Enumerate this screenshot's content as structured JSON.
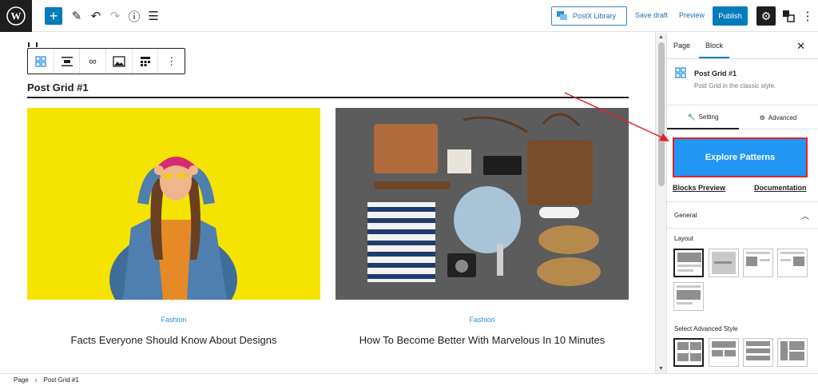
{
  "topbar": {
    "postx_library": "PostX Library",
    "save_draft": "Save draft",
    "preview": "Preview",
    "publish": "Publish"
  },
  "editor": {
    "grid_title": "Post Grid #1",
    "posts": [
      {
        "category": "Fashion",
        "title": "Facts Everyone Should Know About Designs"
      },
      {
        "category": "Fashion",
        "title": "How To Become Better With Marvelous In 10 Minutes"
      }
    ]
  },
  "sidebar": {
    "tabs": [
      "Page",
      "Block"
    ],
    "block_name": "Post Grid #1",
    "block_desc": "Post Grid in the classic style.",
    "setting_tab": "Setting",
    "advanced_tab": "Advanced",
    "explore_button": "Explore Patterns",
    "blocks_preview": "Blocks Preview",
    "documentation": "Documentation",
    "general": "General",
    "layout_label": "Layout",
    "advanced_style_label": "Select Advanced Style"
  },
  "footer": {
    "crumbs": [
      "Page",
      "Post Grid #1"
    ]
  },
  "colors": {
    "accent": "#007cba",
    "explore_bg": "#2196f3",
    "arrow": "#e2202a",
    "link": "#2e8ee0"
  }
}
